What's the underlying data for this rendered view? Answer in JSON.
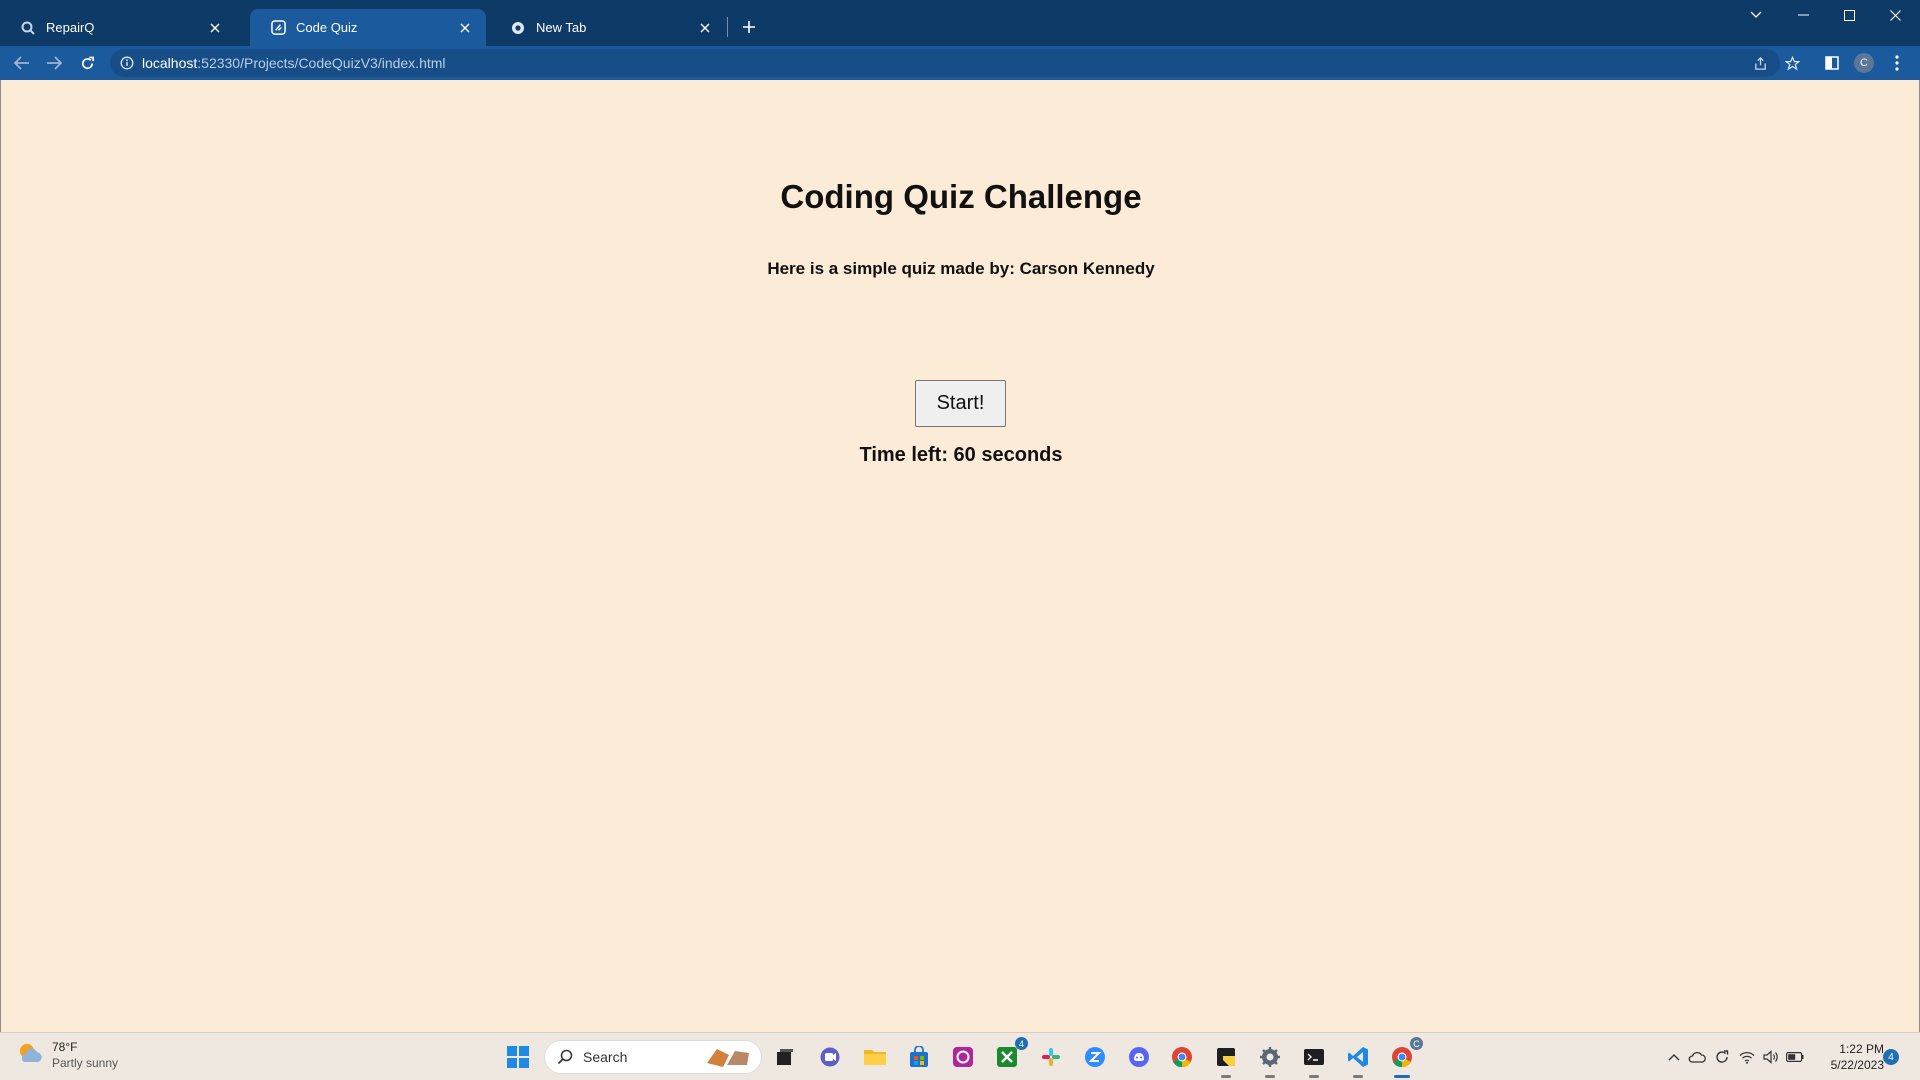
{
  "browser": {
    "tabs": [
      {
        "label": "RepairQ",
        "icon": "search-icon",
        "active": false
      },
      {
        "label": "Code Quiz",
        "icon": "code-quiz-favicon",
        "active": true
      },
      {
        "label": "New Tab",
        "icon": "chrome-icon",
        "active": false
      }
    ],
    "url_host": "localhost",
    "url_path": ":52330/Projects/CodeQuizV3/index.html",
    "profile_initial": "C"
  },
  "page": {
    "heading": "Coding Quiz Challenge",
    "subtitle": "Here is a simple quiz made by: Carson Kennedy",
    "start_label": "Start!",
    "timer_text": "Time left: 60 seconds",
    "background": "#fbebd7"
  },
  "taskbar": {
    "weather_temp": "78°F",
    "weather_condition": "Partly sunny",
    "search_label": "Search",
    "time": "1:22 PM",
    "date": "5/22/2023",
    "notification_count": "4",
    "xbox_badge": "4",
    "chrome_badge": "C"
  },
  "colors": {
    "tabbar": "#0e3a68",
    "toolbar": "#1b5a9c",
    "accent": "#1f6fb5"
  }
}
